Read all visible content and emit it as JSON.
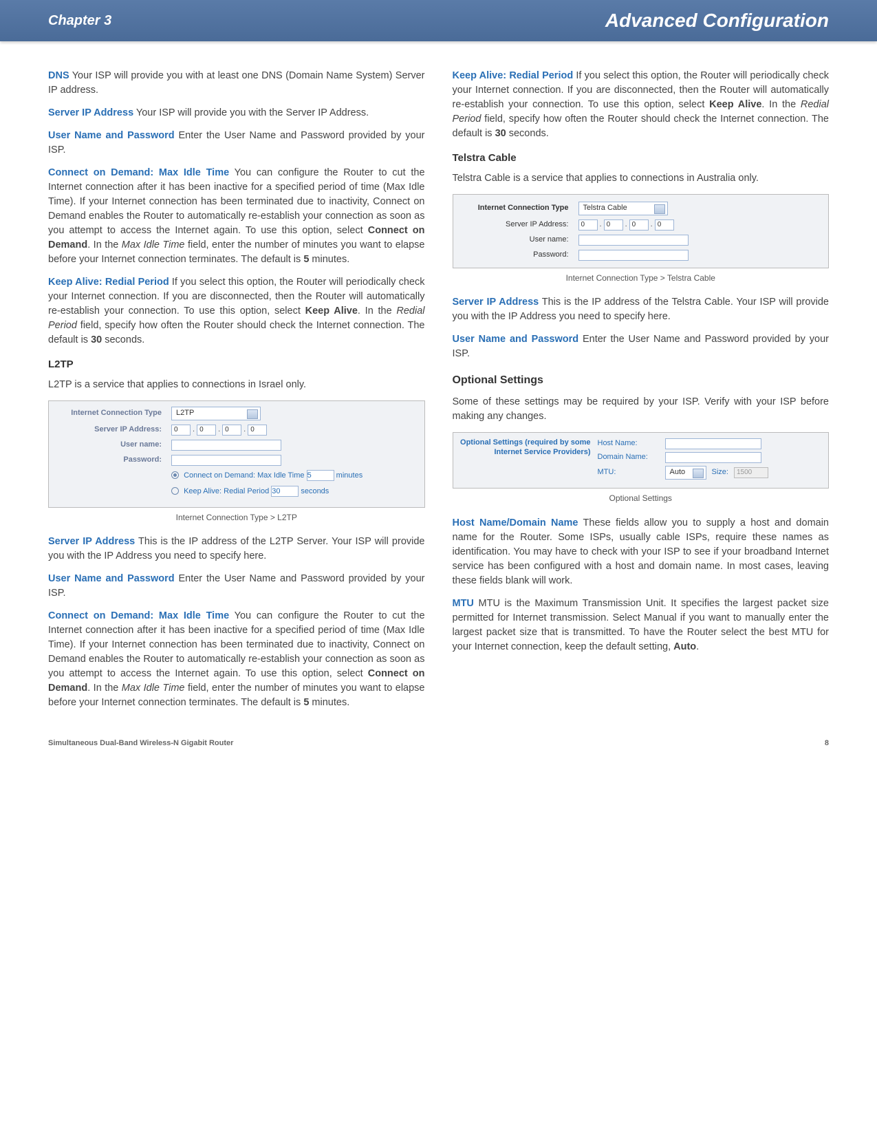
{
  "header": {
    "chapter": "Chapter 3",
    "title": "Advanced Configuration"
  },
  "left": {
    "dns": {
      "term": "DNS",
      "text": "  Your ISP will provide you with at least one DNS (Domain Name System) Server IP address."
    },
    "sip": {
      "term": "Server IP Address",
      "text": "  Your ISP will provide you with the Server IP Address."
    },
    "upw": {
      "term": "User Name and Password",
      "text": "  Enter the User Name and Password provided by your ISP."
    },
    "cod": {
      "term": "Connect on Demand: Max Idle Time",
      "t1": "  You can configure the Router to cut the Internet connection after it has been inactive for a specified period of time (Max Idle Time). If your Internet connection has been terminated due to inactivity, Connect on Demand enables the Router to automatically re-establish your connection as soon as you attempt to access the Internet again. To use this option, select ",
      "b1": "Connect on Demand",
      "t2": ". In the ",
      "i1": "Max Idle Time",
      "t3": " field, enter the number of minutes you want to elapse before your Internet connection terminates. The default is ",
      "b2": "5",
      "t4": " minutes."
    },
    "ka": {
      "term": "Keep Alive: Redial Period",
      "t1": "  If you select this option, the Router will periodically check your Internet connection. If you are disconnected, then the Router will automatically re-establish your connection. To use this option, select ",
      "b1": "Keep Alive",
      "t2": ". In the ",
      "i1": "Redial Period",
      "t3": " field, specify how often the Router should check the Internet connection. The default is ",
      "b2": "30",
      "t4": " seconds."
    },
    "l2tp_h": "L2TP",
    "l2tp_p": "L2TP is a service that applies to connections in Israel only.",
    "l2tp_sc": {
      "conn_label": "Internet Connection Type",
      "conn_value": "L2TP",
      "sip": "Server IP Address:",
      "ip": [
        "0",
        "0",
        "0",
        "0"
      ],
      "user": "User name:",
      "pass": "Password:",
      "cod_label": "Connect on Demand: Max Idle Time",
      "cod_val": "5",
      "cod_unit": "minutes",
      "ka_label": "Keep Alive: Redial Period",
      "ka_val": "30",
      "ka_unit": "seconds"
    },
    "l2tp_cap": "Internet Connection Type > L2TP",
    "sip2": {
      "term": "Server IP Address",
      "text": "  This is the IP address of the L2TP Server. Your ISP will provide you with the IP Address you need to specify here."
    },
    "upw2": {
      "term": "User Name and Password",
      "text": "  Enter the User Name and Password provided by your ISP."
    },
    "cod2_term": "Connect on Demand: Max Idle Time"
  },
  "right": {
    "ka": {
      "term": "Keep Alive: Redial Period",
      "t1": "  If you select this option, the Router will periodically check your Internet connection. If you are disconnected, then the Router will automatically re-establish your connection. To use this option, select ",
      "b1": "Keep Alive",
      "t2": ". In the ",
      "i1": "Redial Period",
      "t3": " field, specify how often the Router should check the Internet connection. The default is ",
      "b2": "30",
      "t4": " seconds."
    },
    "telstra_h": "Telstra Cable",
    "telstra_p": "Telstra Cable is a service that applies to connections in Australia only.",
    "telstra_sc": {
      "conn_label": "Internet Connection Type",
      "conn_value": "Telstra Cable",
      "sip": "Server IP Address:",
      "ip": [
        "0",
        "0",
        "0",
        "0"
      ],
      "user": "User name:",
      "pass": "Password:"
    },
    "telstra_cap": "Internet Connection Type > Telstra Cable",
    "sip": {
      "term": "Server IP Address",
      "text": "  This is the IP address of the Telstra Cable. Your ISP will provide you with the IP Address you need to specify here."
    },
    "upw": {
      "term": "User Name and Password",
      "text": "  Enter the User Name and Password provided by your ISP."
    },
    "opt_h": "Optional Settings",
    "opt_p": "Some of these settings may be required by your ISP. Verify with your ISP before making any changes.",
    "opt_sc": {
      "header": "Optional Settings (required by some Internet Service Providers)",
      "host": "Host Name:",
      "domain": "Domain Name:",
      "mtu": "MTU:",
      "mtu_sel": "Auto",
      "size_lbl": "Size:",
      "size_val": "1500"
    },
    "opt_cap": "Optional Settings",
    "host": {
      "term": "Host Name/Domain Name",
      "text": "  These fields allow you to supply a host and domain name for the Router. Some ISPs, usually cable ISPs, require these names as identification. You may have to check with your ISP to see if your broadband Internet service has been configured with a host and domain name. In most cases, leaving these fields blank will work."
    },
    "mtu": {
      "term": "MTU",
      "t1": "  MTU is the Maximum Transmission Unit. It specifies the largest packet size permitted for Internet transmission. Select Manual if you want to manually enter the largest packet size that is transmitted. To have the Router select the best MTU for your Internet connection, keep the default setting, ",
      "b1": "Auto",
      "t2": "."
    }
  },
  "footer": {
    "product": "Simultaneous Dual-Band Wireless-N Gigabit Router",
    "page": "8"
  }
}
